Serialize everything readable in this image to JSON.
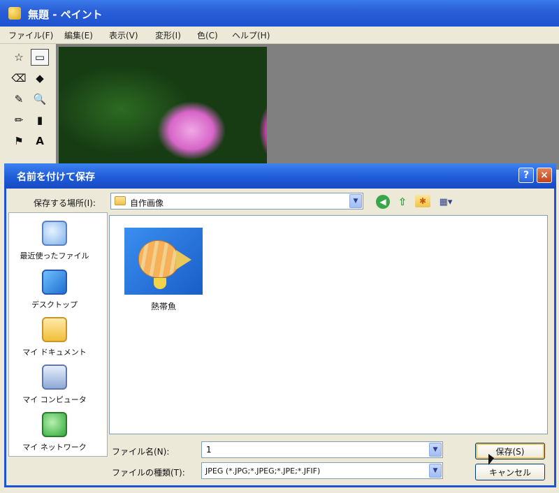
{
  "paint": {
    "title": "無題 - ペイント",
    "menu": [
      "ファイル(F)",
      "編集(E)",
      "表示(V)",
      "変形(I)",
      "色(C)",
      "ヘルプ(H)"
    ]
  },
  "dialog": {
    "title": "名前を付けて保存",
    "help_label": "?",
    "close_label": "×",
    "save_in_label": "保存する場所(I):",
    "save_in_value": "自作画像",
    "places": [
      "最近使ったファイル",
      "デスクトップ",
      "マイ ドキュメント",
      "マイ コンピュータ",
      "マイ ネットワーク"
    ],
    "file_item_label": "熱帯魚",
    "filename_label": "ファイル名(N):",
    "filename_value": "1",
    "filetype_label": "ファイルの種類(T):",
    "filetype_value": "JPEG (*.JPG;*.JPEG;*.JPE;*.JFIF)",
    "save_button": "保存(S)",
    "cancel_button": "キャンセル"
  },
  "icons": {
    "back": "back-arrow-icon",
    "up": "up-folder-icon",
    "new_folder": "new-folder-icon",
    "view_menu": "view-menu-icon"
  }
}
